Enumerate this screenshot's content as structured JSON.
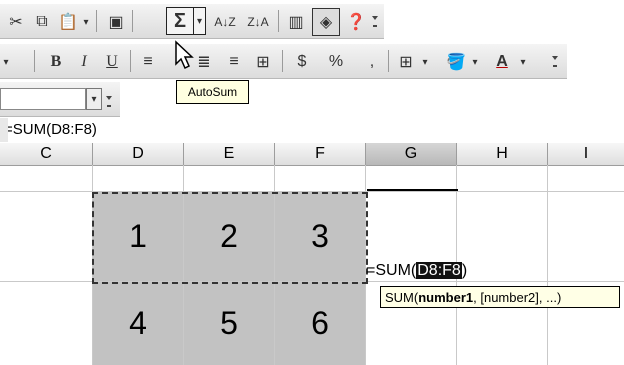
{
  "toolbar1": {
    "autosum_symbol": "Σ",
    "sort_asc": "A↓Z",
    "sort_desc": "Z↓A"
  },
  "toolbar2": {
    "bold": "B",
    "italic": "I",
    "underline": "U",
    "currency": "$",
    "percent": "%",
    "comma": ","
  },
  "tooltip": {
    "text": "AutoSum"
  },
  "formula_bar": {
    "content": "=SUM(D8:F8)"
  },
  "columns": [
    "C",
    "D",
    "E",
    "F",
    "G",
    "H",
    "I"
  ],
  "active_column": "G",
  "cells": {
    "row1": [
      "1",
      "2",
      "3"
    ],
    "row2": [
      "4",
      "5",
      "6"
    ]
  },
  "edit_cell": {
    "prefix": "=SUM(",
    "range": "D8:F8",
    "suffix": ")"
  },
  "arg_tooltip": {
    "fn": "SUM(",
    "arg1": "number1",
    "rest": ", [number2], ...)"
  }
}
